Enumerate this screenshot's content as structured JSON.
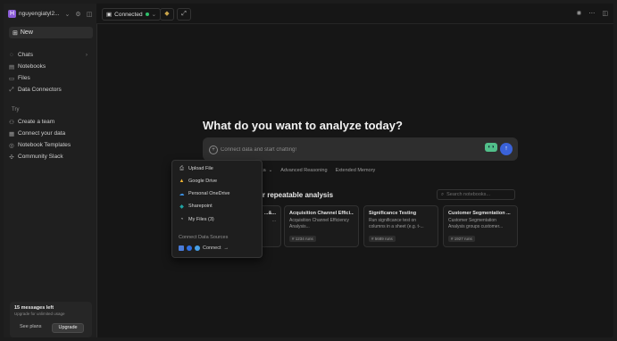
{
  "workspace": {
    "name": "nguyengiatyl2...",
    "logo_glyph": "H"
  },
  "sidebar": {
    "new_label": "New",
    "items": [
      {
        "icon": "chat-icon",
        "label": "Chats"
      },
      {
        "icon": "notebook-icon",
        "label": "Notebooks"
      },
      {
        "icon": "file-icon",
        "label": "Files"
      },
      {
        "icon": "connector-icon",
        "label": "Data Connectors"
      }
    ],
    "try_title": "Try",
    "try_items": [
      {
        "icon": "team-icon",
        "label": "Create a team"
      },
      {
        "icon": "database-icon",
        "label": "Connect your data"
      },
      {
        "icon": "template-icon",
        "label": "Notebook Templates"
      },
      {
        "icon": "slack-icon",
        "label": "Community Slack"
      }
    ],
    "usage": {
      "title": "15 messages left",
      "subtitle": "Upgrade for unlimited usage",
      "see_plans": "See plans",
      "upgrade": "Upgrade"
    }
  },
  "topbar": {
    "connection_label": "Connected"
  },
  "main": {
    "headline": "What do you want to analyze today?",
    "chat_placeholder": "Connect data and start chatting!",
    "options": [
      {
        "label": "ata"
      },
      {
        "label": "Advanced Reasoning"
      },
      {
        "label": "Extended Memory"
      }
    ],
    "section_title": "or repeatable analysis",
    "search_placeholder": "Search notebooks...",
    "cards": [
      {
        "title": "...&...",
        "desc": "...",
        "tag": ""
      },
      {
        "title": "Acquisition Channel Effici...",
        "desc": "Acquisition Channel Efficiency Analysis...",
        "tag": "# 1234 runs"
      },
      {
        "title": "Significance Testing",
        "desc": "Run significance test on columns in a sheet (e.g. t-...",
        "tag": "# 5689 runs"
      },
      {
        "title": "Customer Segmentation ...",
        "desc": "Customer Segmentation Analysis groups customer...",
        "tag": "# 1927 runs"
      }
    ]
  },
  "dropdown": {
    "items": [
      {
        "icon": "upload-icon",
        "label": "Upload File"
      },
      {
        "icon": "google-drive-icon",
        "label": "Google Drive"
      },
      {
        "icon": "onedrive-icon",
        "label": "Personal OneDrive"
      },
      {
        "icon": "sharepoint-icon",
        "label": "Sharepoint"
      },
      {
        "icon": "my-files-icon",
        "label": "My Files (3)"
      }
    ],
    "section_title": "Connect Data Sources",
    "connect_label": "Connect"
  },
  "colors": {
    "accent": "#3a62d8",
    "status": "#2fbf6a",
    "logo": "#8a5bd6"
  }
}
